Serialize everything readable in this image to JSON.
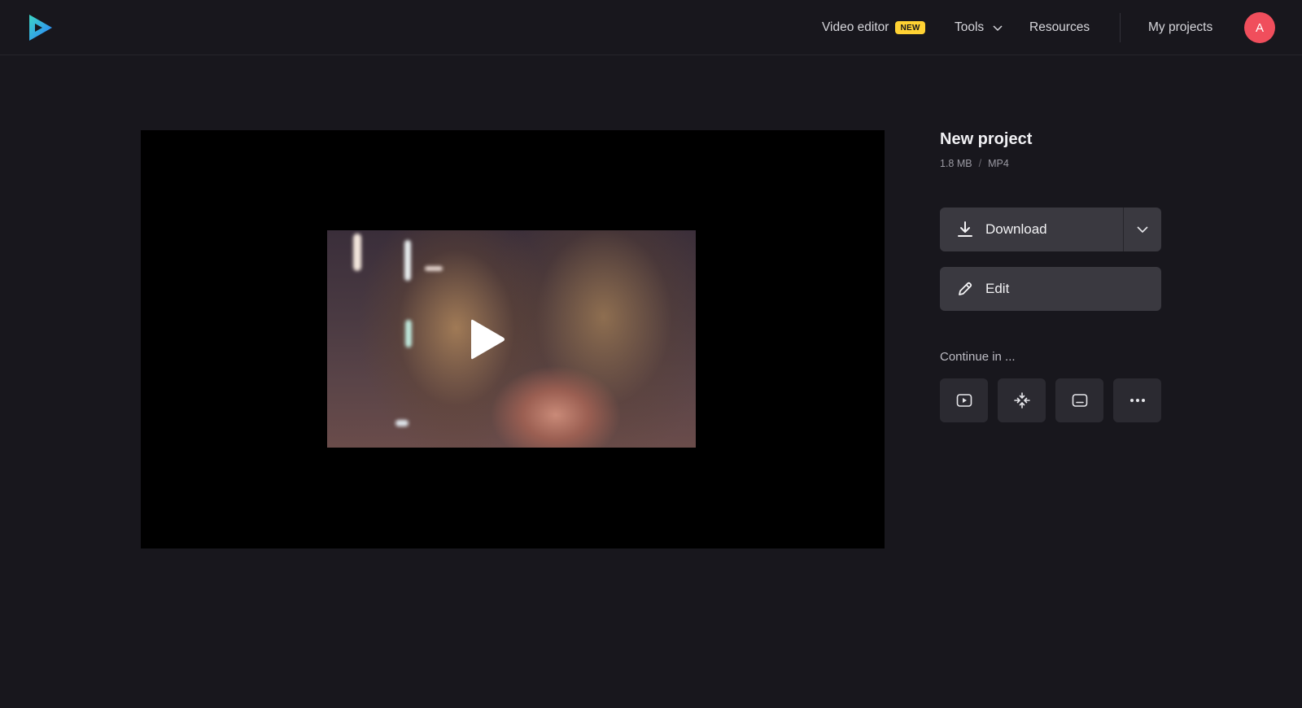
{
  "header": {
    "logo_icon": "play-logo-icon",
    "nav": {
      "video_editor": "Video editor",
      "new_badge": "NEW",
      "tools": "Tools",
      "resources": "Resources",
      "my_projects": "My projects"
    },
    "avatar_initial": "A",
    "colors": {
      "badge": "#ffd233",
      "avatar": "#f04e5c"
    }
  },
  "player": {
    "play_icon": "play-icon",
    "background": "#000000"
  },
  "project": {
    "title": "New project",
    "size": "1.8 MB",
    "separator": "/",
    "format": "MP4"
  },
  "actions": {
    "download_label": "Download",
    "download_icon": "download-icon",
    "download_more_icon": "chevron-down-icon",
    "edit_label": "Edit",
    "edit_icon": "pencil-icon"
  },
  "continue_in": {
    "label": "Continue in ...",
    "tools": [
      {
        "icon": "video-player-icon"
      },
      {
        "icon": "compress-icon"
      },
      {
        "icon": "subtitles-icon"
      },
      {
        "icon": "more-icon"
      }
    ]
  }
}
